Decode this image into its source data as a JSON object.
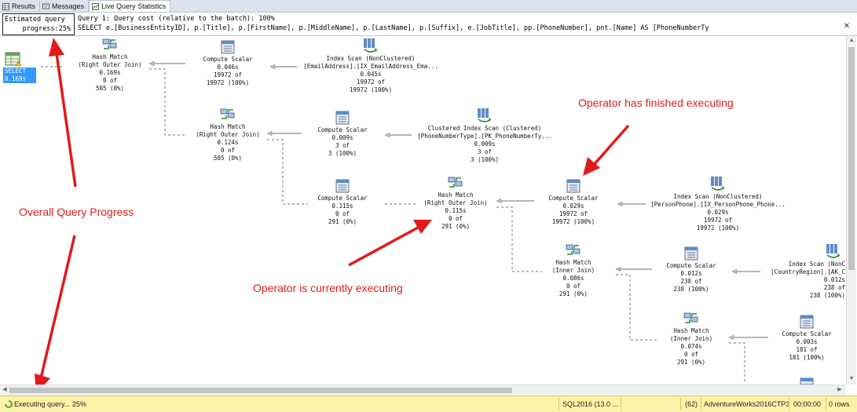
{
  "tabs": [
    {
      "label": "Results",
      "icon": "grid-icon",
      "active": false
    },
    {
      "label": "Messages",
      "icon": "messages-icon",
      "active": false
    },
    {
      "label": "Live Query Statistics",
      "icon": "live-stats-icon",
      "active": true
    }
  ],
  "progress": {
    "line1": "Estimated query",
    "line2": "progress:25%"
  },
  "query_header": {
    "line1": "Query 1: Query cost (relative to the batch): 100%",
    "line2": "SELECT e.[BusinessEntityID], p.[Title], p.[FirstName], p.[MiddleName], p.[LastName], p.[Suffix], e.[JobTitle], pp.[PhoneNumber], pnt.[Name] AS [PhoneNumberTy"
  },
  "select_node": {
    "label1": "SELECT",
    "label2": "0.169s"
  },
  "operators": [
    {
      "id": "hm1",
      "icon": "hash-match-icon",
      "lines": [
        "Hash Match",
        "(Right Outer Join)",
        "0.169s",
        "0 of",
        "505 (0%)"
      ]
    },
    {
      "id": "cs1",
      "icon": "compute-scalar-icon",
      "lines": [
        "Compute Scalar",
        "0.046s",
        "19972 of",
        "19972 (100%)"
      ]
    },
    {
      "id": "is1",
      "icon": "index-scan-icon",
      "lines": [
        "Index Scan (NonClustered)",
        "[EmailAddress].[IX_EmailAddress_Ema...",
        "0.045s",
        "19972 of",
        "19972 (100%)"
      ]
    },
    {
      "id": "hm2",
      "icon": "hash-match-icon",
      "lines": [
        "Hash Match",
        "(Right Outer Join)",
        "0.124s",
        "0 of",
        "505 (0%)"
      ]
    },
    {
      "id": "cs2",
      "icon": "compute-scalar-icon",
      "lines": [
        "Compute Scalar",
        "0.009s",
        "3 of",
        "3 (100%)"
      ]
    },
    {
      "id": "ci1",
      "icon": "clustered-index-scan-icon",
      "lines": [
        "Clustered Index Scan (Clustered)",
        "[PhoneNumberType].[PK_PhoneNumberTy...",
        "0.009s",
        "3 of",
        "3 (100%)"
      ]
    },
    {
      "id": "cs3",
      "icon": "compute-scalar-icon",
      "lines": [
        "Compute Scalar",
        "0.115s",
        "0 of",
        "291 (0%)"
      ]
    },
    {
      "id": "hm3",
      "icon": "hash-match-icon",
      "lines": [
        "Hash Match",
        "(Right Outer Join)",
        "0.115s",
        "0 of",
        "291 (0%)"
      ]
    },
    {
      "id": "cs4",
      "icon": "compute-scalar-icon",
      "lines": [
        "Compute Scalar",
        "0.029s",
        "19972 of",
        "19972 (100%)"
      ]
    },
    {
      "id": "is2",
      "icon": "index-scan-icon",
      "lines": [
        "Index Scan (NonClustered)",
        "[PersonPhone].[IX_PersonPhone_Phone...",
        "0.029s",
        "19972 of",
        "19972 (100%)"
      ]
    },
    {
      "id": "hm4",
      "icon": "hash-match-icon",
      "lines": [
        "Hash Match",
        "(Inner Join)",
        "0.086s",
        "0 of",
        "291 (0%)"
      ]
    },
    {
      "id": "cs5",
      "icon": "compute-scalar-icon",
      "lines": [
        "Compute Scalar",
        "0.012s",
        "238 of",
        "238 (100%)"
      ]
    },
    {
      "id": "is3",
      "icon": "index-scan-icon",
      "lines": [
        "Index Scan (NonC",
        "[CountryRegion].[AK_C",
        "0.012s",
        "238 of",
        "238 (100%)"
      ]
    },
    {
      "id": "hm5",
      "icon": "hash-match-icon",
      "lines": [
        "Hash Match",
        "(Inner Join)",
        "0.074s",
        "0 of",
        "291 (0%)"
      ]
    },
    {
      "id": "cs6",
      "icon": "compute-scalar-icon",
      "lines": [
        "Compute Scalar",
        "0.003s",
        "181 of",
        "181 (100%)"
      ]
    }
  ],
  "annotations": {
    "overall": "Overall Query Progress",
    "finished": "Operator has finished executing",
    "executing": "Operator is currently executing"
  },
  "status_bar": {
    "executing": "Executing query... 25%",
    "server": "SQL2016 (13.0 ...",
    "spid": "(62)",
    "database": "AdventureWorks2016CTP3",
    "elapsed": "00:00:00",
    "rows": "0 rows"
  },
  "colors": {
    "accent": "#3399ff",
    "annotation": "#e01b1b",
    "status_bg": "#fdf3a8"
  }
}
